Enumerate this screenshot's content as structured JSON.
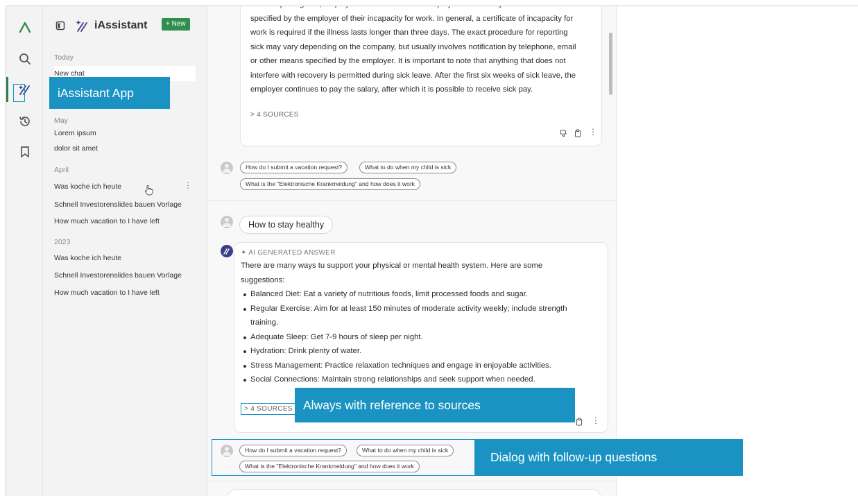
{
  "sidebar": {
    "title": "iAssistant",
    "new_label": "+ New",
    "today_label": "Today",
    "today_item": "New chat",
    "may_label": "May",
    "may_items": [
      "Lorem ipsum",
      "dolor sit amet"
    ],
    "april_label": "April",
    "april_items": [
      "Was koche ich heute",
      "Schnell Investorenslides bauen Vorlage",
      "How much vacation to I have left"
    ],
    "year_label": "2023",
    "year_items": [
      "Was koche ich heute",
      "Schnell Investorenslides bauen Vorlage",
      "How much vacation to I have left"
    ],
    "more_label": "⋮"
  },
  "chat": {
    "first_answer_lines": [
      "When reporting sick, employees should inform the employer immediately and in the form",
      "specified by the employer of their incapacity for work. In general, a certificate of incapacity for",
      "work is required if the illness lasts longer than three days. The exact procedure for reporting",
      "sick may vary depending on the company, but usually involves notification by telephone, email",
      "or other means specified by the employer. It is important to note that anything that does not",
      "interfere with recovery is permitted during sick leave. After the first six weeks of sick leave, the",
      "employer continues to pay the salary, after which it is possible to receive sick pay."
    ],
    "sources_label": "> 4 SOURCES",
    "followups": [
      "How do I submit a vacation request?",
      "What to do when my child is sick",
      "What is the \"Elektronische Krankmeldung\" and how does it work"
    ],
    "question": "How to stay healthy",
    "ai_label": "✦ AI GENERATED ANSWER",
    "answer_intro_1": "There are many ways tu support your physical or mental health system.  Here are some",
    "answer_intro_2": "suggestions:",
    "bullets": [
      "Balanced Diet: Eat a variety of nutritious foods, limit processed foods and sugar.",
      "Regular Exercise: Aim for at least 150 minutes of moderate activity weekly; include strength",
      "Adequate Sleep: Get 7-9 hours of sleep per night.",
      "Hydration: Drink plenty of water.",
      "Stress Management: Practice relaxation techniques and engage in enjoyable activities.",
      "Social Connections: Maintain strong relationships and seek support when needed."
    ],
    "bullet_cont": "training.",
    "more_label": "⋮"
  },
  "callouts": {
    "app": "iAssistant App",
    "sources": "Always with reference to sources",
    "dialog": "Dialog with follow-up questions"
  },
  "colors": {
    "accent": "#1a93c2",
    "brand_green": "#2f8f4e"
  }
}
